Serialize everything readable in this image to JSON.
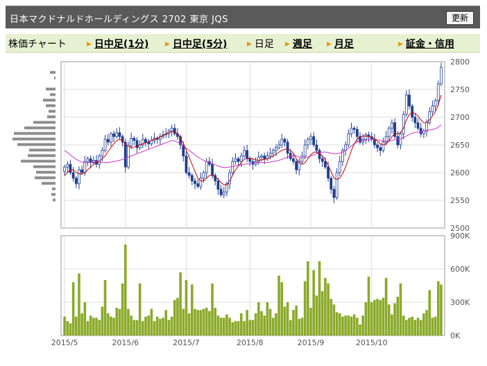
{
  "header": {
    "title": "日本マクドナルドホールディングス 2702 東京 JQS",
    "refresh_label": "更新"
  },
  "tabs": [
    {
      "label": "株価チャート",
      "link": false,
      "arrow": false
    },
    {
      "label": "日中足(1分)",
      "link": true,
      "arrow": true
    },
    {
      "label": "日中足(5分)",
      "link": true,
      "arrow": true
    },
    {
      "label": "日足",
      "link": false,
      "arrow": true
    },
    {
      "label": "週足",
      "link": true,
      "arrow": true
    },
    {
      "label": "月足",
      "link": true,
      "arrow": true
    },
    {
      "label": "証金・信用",
      "link": true,
      "arrow": true
    }
  ],
  "colors": {
    "up_candle": "#ffffff",
    "down_candle": "#1f3f8f",
    "ma_short": "#cc0000",
    "ma_long": "#cc33cc",
    "volume_bar": "#8aaa2a",
    "volume_profile": "#8c8c8c",
    "grid": "#dddddd"
  },
  "chart_data": [
    {
      "type": "candlestick",
      "title": "",
      "x_tick_labels": [
        "2015/5",
        "2015/6",
        "2015/7",
        "2015/8",
        "2015/9",
        "2015/10"
      ],
      "x_tick_index": [
        0,
        21,
        42,
        64,
        85,
        106
      ],
      "price_ticks": [
        2500,
        2550,
        2600,
        2650,
        2700,
        2750,
        2800
      ],
      "ylim": [
        2500,
        2800
      ],
      "close": [
        2610,
        2615,
        2600,
        2590,
        2580,
        2605,
        2600,
        2620,
        2625,
        2618,
        2622,
        2615,
        2630,
        2640,
        2660,
        2655,
        2670,
        2665,
        2672,
        2665,
        2655,
        2610,
        2648,
        2662,
        2658,
        2645,
        2650,
        2660,
        2655,
        2652,
        2658,
        2662,
        2660,
        2665,
        2668,
        2670,
        2675,
        2680,
        2670,
        2665,
        2650,
        2630,
        2600,
        2595,
        2585,
        2580,
        2575,
        2590,
        2600,
        2620,
        2615,
        2595,
        2585,
        2570,
        2560,
        2565,
        2580,
        2600,
        2620,
        2625,
        2620,
        2630,
        2640,
        2625,
        2620,
        2615,
        2620,
        2628,
        2630,
        2625,
        2630,
        2635,
        2640,
        2645,
        2650,
        2660,
        2655,
        2635,
        2625,
        2620,
        2605,
        2620,
        2630,
        2650,
        2660,
        2665,
        2650,
        2640,
        2625,
        2620,
        2610,
        2590,
        2570,
        2555,
        2600,
        2620,
        2640,
        2650,
        2670,
        2680,
        2678,
        2665,
        2655,
        2660,
        2668,
        2665,
        2660,
        2650,
        2645,
        2640,
        2655,
        2665,
        2680,
        2690,
        2665,
        2650,
        2670,
        2705,
        2740,
        2720,
        2700,
        2690,
        2680,
        2670,
        2675,
        2690,
        2710,
        2720,
        2730,
        2760,
        2790
      ],
      "ma_short": [
        2595,
        2600,
        2605,
        2605,
        2600,
        2598,
        2597,
        2600,
        2605,
        2610,
        2615,
        2618,
        2620,
        2625,
        2630,
        2638,
        2645,
        2652,
        2658,
        2660,
        2658,
        2650,
        2648,
        2645,
        2646,
        2648,
        2650,
        2652,
        2654,
        2656,
        2658,
        2660,
        2662,
        2664,
        2667,
        2670,
        2672,
        2674,
        2674,
        2670,
        2662,
        2652,
        2640,
        2628,
        2615,
        2602,
        2590,
        2585,
        2585,
        2590,
        2595,
        2595,
        2592,
        2588,
        2582,
        2578,
        2578,
        2585,
        2595,
        2605,
        2612,
        2618,
        2624,
        2626,
        2626,
        2625,
        2623,
        2622,
        2623,
        2624,
        2625,
        2627,
        2630,
        2633,
        2637,
        2640,
        2642,
        2643,
        2640,
        2635,
        2625,
        2618,
        2615,
        2618,
        2625,
        2632,
        2637,
        2637,
        2635,
        2630,
        2623,
        2613,
        2602,
        2590,
        2588,
        2590,
        2598,
        2610,
        2625,
        2640,
        2652,
        2660,
        2665,
        2666,
        2666,
        2665,
        2664,
        2661,
        2657,
        2652,
        2650,
        2652,
        2657,
        2665,
        2670,
        2670,
        2672,
        2680,
        2695,
        2705,
        2708,
        2707,
        2702,
        2695,
        2690,
        2690,
        2695,
        2702,
        2710,
        2722,
        2740
      ],
      "ma_long": [
        2640,
        2636,
        2632,
        2628,
        2624,
        2621,
        2619,
        2618,
        2618,
        2619,
        2620,
        2620,
        2619,
        2618,
        2618,
        2618,
        2619,
        2620,
        2621,
        2622,
        2624,
        2626,
        2628,
        2630,
        2632,
        2634,
        2636,
        2638,
        2640,
        2642,
        2644,
        2646,
        2648,
        2650,
        2652,
        2654,
        2656,
        2658,
        2657,
        2655,
        2652,
        2648,
        2644,
        2640,
        2636,
        2632,
        2628,
        2625,
        2622,
        2620,
        2618,
        2616,
        2614,
        2612,
        2610,
        2609,
        2609,
        2610,
        2611,
        2612,
        2613,
        2614,
        2615,
        2616,
        2616,
        2617,
        2618,
        2618,
        2618,
        2618,
        2618,
        2619,
        2620,
        2621,
        2622,
        2624,
        2626,
        2628,
        2630,
        2630,
        2630,
        2628,
        2627,
        2627,
        2628,
        2630,
        2632,
        2634,
        2636,
        2637,
        2637,
        2636,
        2635,
        2634,
        2634,
        2635,
        2637,
        2640,
        2644,
        2648,
        2652,
        2655,
        2657,
        2658,
        2659,
        2659,
        2660,
        2660,
        2659,
        2658,
        2657,
        2657,
        2657,
        2658,
        2659,
        2660,
        2661,
        2663,
        2666,
        2669,
        2671,
        2672,
        2673,
        2674,
        2675,
        2676,
        2677,
        2678,
        2679,
        2682,
        2686
      ],
      "volume_profile_levels": [
        2550,
        2560,
        2570,
        2580,
        2590,
        2600,
        2610,
        2620,
        2630,
        2640,
        2650,
        2660,
        2670,
        2680,
        2690,
        2700,
        2710,
        2720,
        2730,
        2740,
        2750,
        2760,
        2770,
        2780
      ],
      "volume_profile_values": [
        4,
        6,
        5,
        20,
        30,
        28,
        32,
        50,
        40,
        38,
        55,
        62,
        60,
        45,
        32,
        12,
        10,
        14,
        18,
        8,
        14,
        0,
        2,
        8
      ]
    },
    {
      "type": "bar",
      "title": "",
      "x_tick_labels": [
        "2015/5",
        "2015/6",
        "2015/7",
        "2015/8",
        "2015/9",
        "2015/10"
      ],
      "volume_ticks": [
        "0K",
        "300K",
        "600K",
        "900K"
      ],
      "ylim": [
        0,
        900000
      ],
      "values": [
        170000,
        130000,
        110000,
        480000,
        170000,
        560000,
        200000,
        300000,
        130000,
        180000,
        160000,
        160000,
        140000,
        260000,
        500000,
        200000,
        170000,
        160000,
        250000,
        240000,
        470000,
        820000,
        240000,
        180000,
        140000,
        140000,
        470000,
        130000,
        170000,
        180000,
        240000,
        130000,
        170000,
        150000,
        160000,
        230000,
        140000,
        170000,
        320000,
        340000,
        570000,
        240000,
        500000,
        200000,
        460000,
        240000,
        230000,
        230000,
        240000,
        250000,
        220000,
        470000,
        250000,
        180000,
        160000,
        160000,
        190000,
        160000,
        120000,
        130000,
        130000,
        200000,
        130000,
        230000,
        140000,
        140000,
        200000,
        300000,
        220000,
        180000,
        300000,
        240000,
        160000,
        200000,
        540000,
        480000,
        260000,
        300000,
        140000,
        230000,
        270000,
        150000,
        160000,
        490000,
        670000,
        250000,
        590000,
        360000,
        670000,
        400000,
        520000,
        470000,
        330000,
        280000,
        210000,
        200000,
        170000,
        180000,
        180000,
        170000,
        190000,
        160000,
        100000,
        180000,
        300000,
        530000,
        300000,
        320000,
        330000,
        320000,
        340000,
        520000,
        280000,
        190000,
        290000,
        350000,
        470000,
        180000,
        140000,
        160000,
        170000,
        140000,
        160000,
        140000,
        200000,
        230000,
        410000,
        160000,
        170000,
        490000,
        460000
      ]
    }
  ]
}
